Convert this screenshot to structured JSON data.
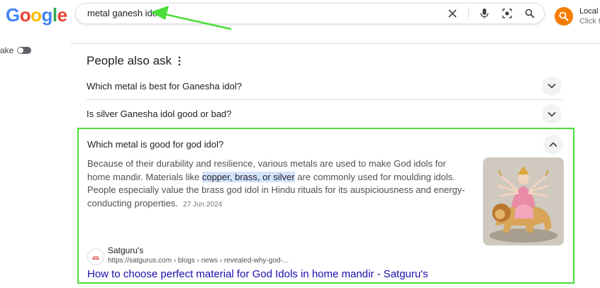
{
  "header": {
    "logo_letters": [
      {
        "ch": "G",
        "color": "#4285F4"
      },
      {
        "ch": "o",
        "color": "#EA4335"
      },
      {
        "ch": "o",
        "color": "#FBBC05"
      },
      {
        "ch": "g",
        "color": "#4285F4"
      },
      {
        "ch": "l",
        "color": "#34A853"
      },
      {
        "ch": "e",
        "color": "#EA4335"
      }
    ],
    "search_query": "metal ganesh idol",
    "icons": [
      "close-icon",
      "mic-icon",
      "lens-icon",
      "search-icon"
    ],
    "local_label": "Local s",
    "local_sub": "Click t"
  },
  "sidebar": {
    "toggle_label": "ake"
  },
  "paa": {
    "title": "People also ask",
    "questions": [
      {
        "text": "Which metal is best for Ganesha idol?"
      },
      {
        "text": "Is silver Ganesha idol good or bad?"
      }
    ],
    "expanded": {
      "question": "Which metal is good for god idol?",
      "answer_part1": "Because of their durability and resilience, various metals are used to make God idols for home mandir. Materials like ",
      "answer_highlight": "copper, brass, or silver",
      "answer_part2": " are commonly used for moulding idols. People especially value the brass god idol in Hindu rituals for its auspiciousness and energy-conducting properties.",
      "date": "27 Jun 2024",
      "source_name": "Satguru's",
      "source_url": "https://satgurus.com › blogs › news › revealed-why-god-...",
      "source_title": "How to choose perfect material for God Idols in home mandir - Satguru's"
    }
  },
  "colors": {
    "annotation_green": "#4cde3a",
    "link_blue": "#1a0dab",
    "highlight": "#d3e3fd",
    "local_orange": "#f57c00"
  }
}
